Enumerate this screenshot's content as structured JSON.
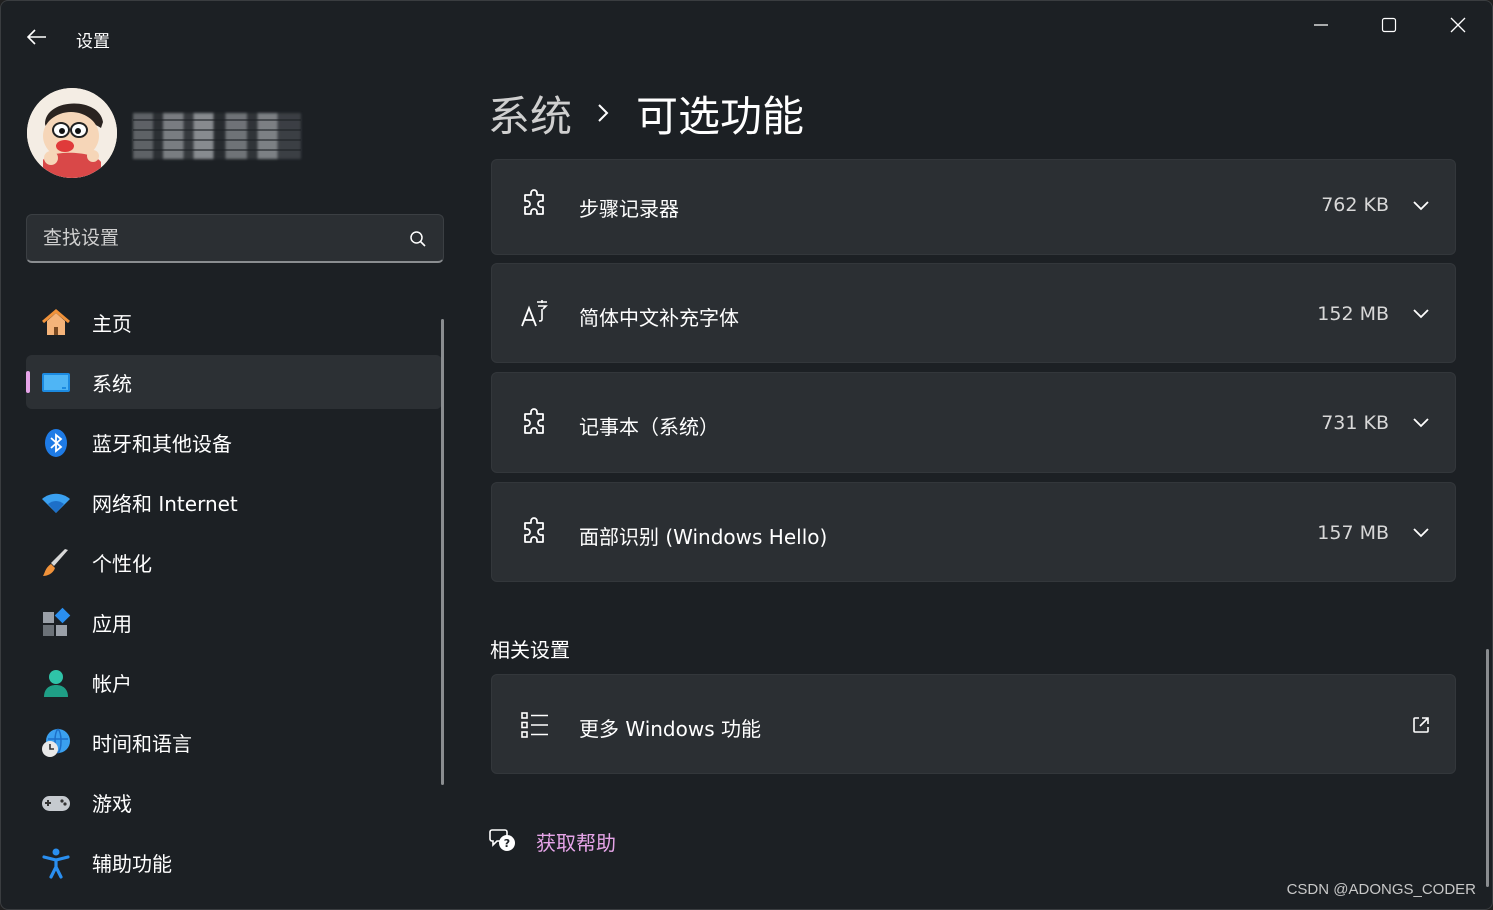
{
  "app": {
    "title": "设置"
  },
  "search": {
    "placeholder": "查找设置"
  },
  "sidebar": {
    "items": [
      {
        "label": "主页",
        "icon": "home-icon"
      },
      {
        "label": "系统",
        "icon": "system-icon",
        "active": true
      },
      {
        "label": "蓝牙和其他设备",
        "icon": "bluetooth-icon"
      },
      {
        "label": "网络和 Internet",
        "icon": "wifi-icon"
      },
      {
        "label": "个性化",
        "icon": "brush-icon"
      },
      {
        "label": "应用",
        "icon": "apps-icon"
      },
      {
        "label": "帐户",
        "icon": "account-icon"
      },
      {
        "label": "时间和语言",
        "icon": "globe-clock-icon"
      },
      {
        "label": "游戏",
        "icon": "gamepad-icon"
      },
      {
        "label": "辅助功能",
        "icon": "accessibility-icon"
      }
    ]
  },
  "breadcrumb": {
    "parent": "系统",
    "current": "可选功能"
  },
  "features": [
    {
      "label": "步骤记录器",
      "size": "762 KB",
      "icon": "puzzle-icon"
    },
    {
      "label": "简体中文补充字体",
      "size": "152 MB",
      "icon": "font-icon"
    },
    {
      "label": "记事本（系统）",
      "size": "731 KB",
      "icon": "puzzle-icon"
    },
    {
      "label": "面部识别 (Windows Hello)",
      "size": "157 MB",
      "icon": "puzzle-icon"
    }
  ],
  "related": {
    "title": "相关设置",
    "more_features": "更多 Windows 功能"
  },
  "help": {
    "label": "获取帮助"
  },
  "watermark": "CSDN @ADONGS_CODER",
  "colors": {
    "accent": "#e6a4e8",
    "card": "#2b2f33",
    "background": "#1c2024"
  }
}
